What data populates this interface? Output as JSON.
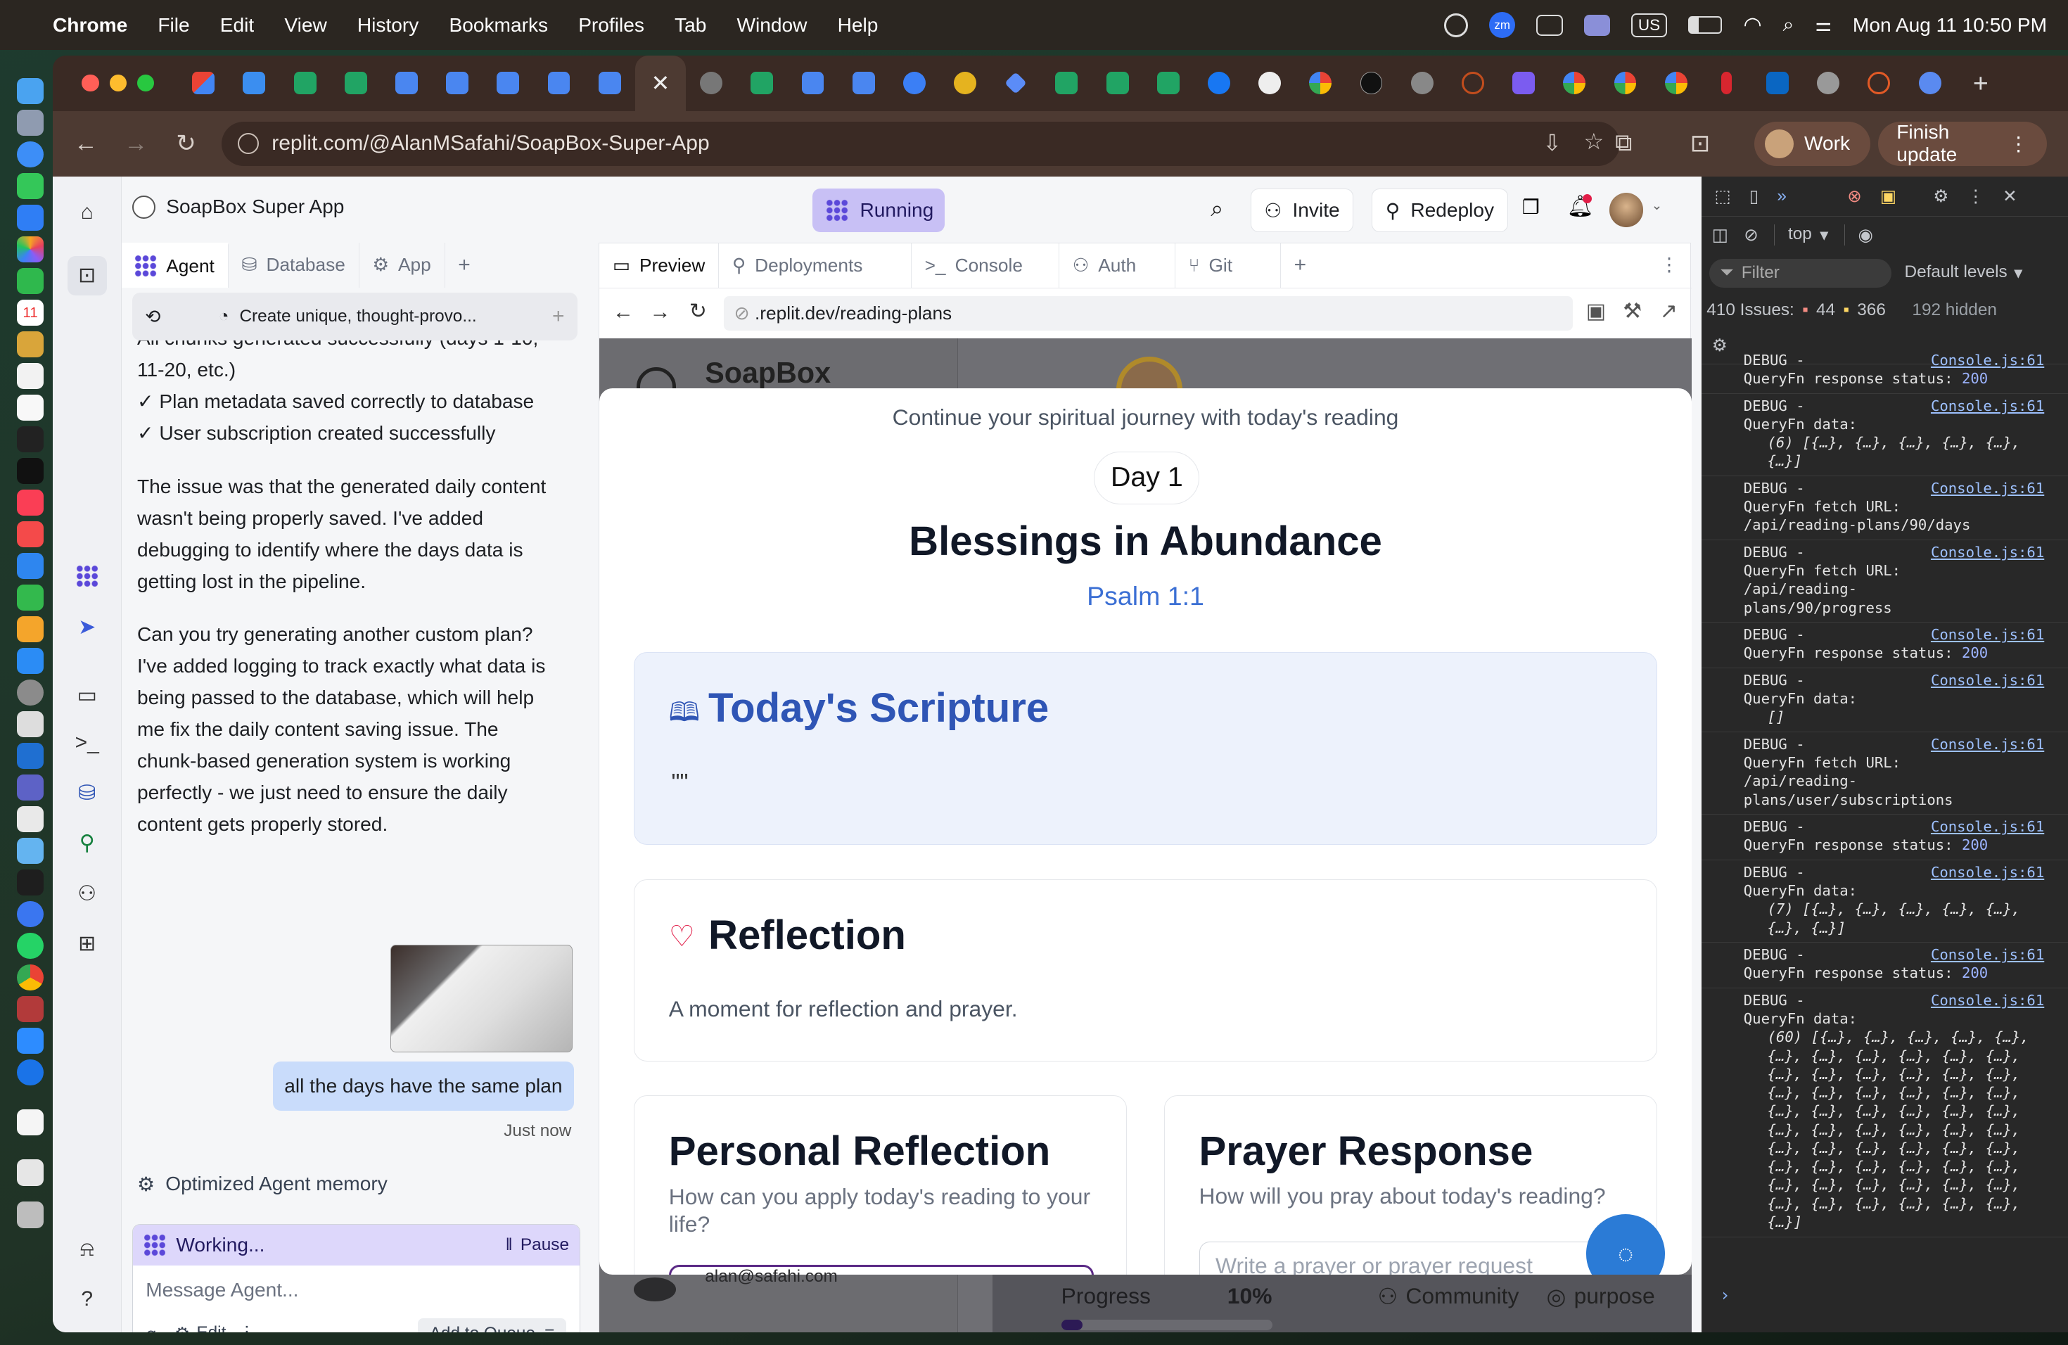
{
  "menubar": {
    "app": "Chrome",
    "items": [
      "File",
      "Edit",
      "View",
      "History",
      "Bookmarks",
      "Profiles",
      "Tab",
      "Window",
      "Help"
    ],
    "clock": "Mon Aug 11  10:50 PM",
    "input_source": "US",
    "zoom_badge": "zm"
  },
  "browser": {
    "url": "replit.com/@AlanMSafahi/SoapBox-Super-App",
    "profile": "Work",
    "update_button": "Finish update"
  },
  "replit": {
    "project_name": "SoapBox Super App",
    "run_status": "Running",
    "invite": "Invite",
    "redeploy": "Redeploy",
    "left_tabs": [
      "Agent",
      "Database",
      "App"
    ],
    "chat_title": "Create unique, thought-provo...",
    "agent_messages": {
      "partial_line": "All chunks generated successfully (days 1-10,",
      "line_cont": "11-20, etc.)",
      "check1": "✓ Plan metadata saved correctly to database",
      "check2": "✓ User subscription created successfully",
      "para1": "The issue was that the generated daily content wasn't being properly saved. I've added debugging to identify where the days data is getting lost in the pipeline.",
      "para2": "Can you try generating another custom plan? I've added logging to track exactly what data is being passed to the database, which will help me fix the daily content saving issue. The chunk-based generation system is working perfectly - we just need to ensure the daily content gets properly stored."
    },
    "user_message": "all the days have the same plan",
    "user_time": "Just now",
    "memory_note": "Optimized Agent memory",
    "working": "Working...",
    "pause": "Pause",
    "composer_placeholder": "Message Agent...",
    "edit": "Edit",
    "add_to_queue": "Add to Queue",
    "right_tabs": [
      "Preview",
      "Deployments",
      "Console",
      "Auth",
      "Git"
    ],
    "preview_url": ".replit.dev/reading-plans"
  },
  "app_page": {
    "brand": "SoapBox",
    "subtitle": "Continue your spiritual journey with today's reading",
    "day_badge": "Day 1",
    "title": "Blessings in Abundance",
    "verse_ref": "Psalm 1:1",
    "scripture_heading": "Today's Scripture",
    "scripture_text": "\"\"",
    "reflection_heading": "Reflection",
    "reflection_text": "A moment for reflection and prayer.",
    "personal_title": "Personal Reflection",
    "personal_prompt": "How can you apply today's reading to your life?",
    "prayer_title": "Prayer Response",
    "prayer_prompt": "How will you pray about today's reading?",
    "prayer_placeholder": "Write a prayer or prayer request",
    "footer_email": "alan@safahi.com",
    "progress_label": "Progress",
    "progress_value": "10%",
    "progress_fraction": 0.1,
    "community": "Community",
    "purpose": "purpose"
  },
  "devtools": {
    "context": "top",
    "filter": "Filter",
    "levels": "Default levels",
    "issues": "410 Issues:",
    "warn_count": "44",
    "info_count": "366",
    "hidden": "192 hidden",
    "src": "Console.js:61",
    "entries": [
      {
        "lines": [
          "DEBUG -",
          "QueryFn response status:"
        ],
        "status": "200"
      },
      {
        "lines": [
          "DEBUG -",
          "QueryFn data:"
        ],
        "detail": "(6) [{…}, {…}, {…}, {…}, {…}, {…}]"
      },
      {
        "lines": [
          "DEBUG -",
          "QueryFn fetch URL:",
          "/api/reading-plans/90/days"
        ]
      },
      {
        "lines": [
          "DEBUG -",
          "QueryFn fetch URL:",
          "/api/reading-",
          "plans/90/progress"
        ]
      },
      {
        "lines": [
          "DEBUG -",
          "QueryFn response status:"
        ],
        "status": "200"
      },
      {
        "lines": [
          "DEBUG -",
          "QueryFn data:"
        ],
        "detail": "[]"
      },
      {
        "lines": [
          "DEBUG -",
          "QueryFn fetch URL:",
          "/api/reading-",
          "plans/user/subscriptions"
        ]
      },
      {
        "lines": [
          "DEBUG -",
          "QueryFn response status:"
        ],
        "status": "200"
      },
      {
        "lines": [
          "DEBUG -",
          "QueryFn data:"
        ],
        "detail": "(7) [{…}, {…}, {…}, {…}, {…}, {…}, {…}]"
      },
      {
        "lines": [
          "DEBUG -",
          "QueryFn response status:"
        ],
        "status": "200"
      },
      {
        "lines": [
          "DEBUG -",
          "QueryFn data:"
        ],
        "detail": "(60) [{…}, {…}, {…}, {…}, {…}, {…}, {…}, {…}, {…}, {…}, {…}, {…}, {…}, {…}, {…}, {…}, {…}, {…}, {…}, {…}, {…}, {…}, {…}, {…}, {…}, {…}, {…}, {…}, {…}, {…}, {…}, {…}, {…}, {…}, {…}, {…}, {…}, {…}, {…}, {…}, {…}, {…}, {…}, {…}, {…}, {…}, {…}, {…}, {…}, {…}, {…}, {…}, {…}, {…}, {…}, {…}, {…}, {…}, {…}, {…}]"
      }
    ]
  },
  "colors": {
    "accent": "#5b48d9",
    "scripture_blue": "#2f55b5",
    "heart": "#e11d48"
  }
}
